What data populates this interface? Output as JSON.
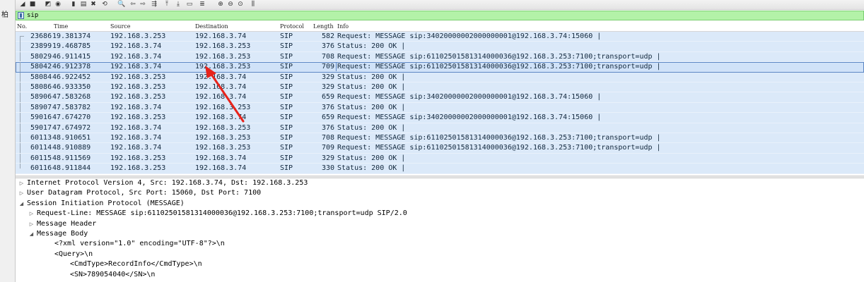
{
  "left_strip": {
    "glyph": "柏"
  },
  "toolbar": {
    "buttons": [
      {
        "name": "open-icon",
        "glyph": "◢"
      },
      {
        "name": "stop-capture-icon",
        "glyph": "■"
      },
      {
        "name": "restart-capture-icon",
        "glyph": "◩"
      },
      {
        "name": "capture-options-icon",
        "glyph": "◉"
      },
      {
        "name": "open-file-icon",
        "glyph": "▮"
      },
      {
        "name": "save-file-icon",
        "glyph": "▤"
      },
      {
        "name": "close-file-icon",
        "glyph": "✖"
      },
      {
        "name": "reload-icon",
        "glyph": "⟲"
      },
      {
        "name": "find-packet-icon",
        "glyph": "🔍"
      },
      {
        "name": "go-back-icon",
        "glyph": "⇦"
      },
      {
        "name": "go-forward-icon",
        "glyph": "⇨"
      },
      {
        "name": "go-to-packet-icon",
        "glyph": "⇶"
      },
      {
        "name": "go-first-icon",
        "glyph": "⤒"
      },
      {
        "name": "go-last-icon",
        "glyph": "⤓"
      },
      {
        "name": "autoscroll-icon",
        "glyph": "▭"
      },
      {
        "name": "colorize-icon",
        "glyph": "≣"
      },
      {
        "name": "zoom-in-icon",
        "glyph": "⊕"
      },
      {
        "name": "zoom-out-icon",
        "glyph": "⊖"
      },
      {
        "name": "zoom-normal-icon",
        "glyph": "⊙"
      },
      {
        "name": "resize-columns-icon",
        "glyph": "⫼"
      }
    ]
  },
  "filter": {
    "value": "sip"
  },
  "packet_list": {
    "columns": [
      "No.",
      "Time",
      "Source",
      "Destination",
      "Protocol",
      "Length",
      "Info"
    ],
    "rows": [
      {
        "no": "23686",
        "time": "19.381374",
        "src": "192.168.3.253",
        "dst": "192.168.3.74",
        "proto": "SIP",
        "len": "582",
        "info": "Request: MESSAGE sip:34020000002000000001@192.168.3.74:15060 |"
      },
      {
        "no": "23899",
        "time": "19.468785",
        "src": "192.168.3.74",
        "dst": "192.168.3.253",
        "proto": "SIP",
        "len": "376",
        "info": "Status: 200 OK |"
      },
      {
        "no": "58029",
        "time": "46.911415",
        "src": "192.168.3.74",
        "dst": "192.168.3.253",
        "proto": "SIP",
        "len": "708",
        "info": "Request: MESSAGE sip:61102501581314000036@192.168.3.253:7100;transport=udp |"
      },
      {
        "no": "58042",
        "time": "46.912378",
        "src": "192.168.3.74",
        "dst": "192.168.3.253",
        "proto": "SIP",
        "len": "709",
        "info": "Request: MESSAGE sip:61102501581314000036@192.168.3.253:7100;transport=udp |",
        "selected": true
      },
      {
        "no": "58084",
        "time": "46.922452",
        "src": "192.168.3.253",
        "dst": "192.168.3.74",
        "proto": "SIP",
        "len": "329",
        "info": "Status: 200 OK |"
      },
      {
        "no": "58086",
        "time": "46.933350",
        "src": "192.168.3.253",
        "dst": "192.168.3.74",
        "proto": "SIP",
        "len": "329",
        "info": "Status: 200 OK |"
      },
      {
        "no": "58906",
        "time": "47.583268",
        "src": "192.168.3.253",
        "dst": "192.168.3.74",
        "proto": "SIP",
        "len": "659",
        "info": "Request: MESSAGE sip:34020000002000000001@192.168.3.74:15060 |"
      },
      {
        "no": "58907",
        "time": "47.583782",
        "src": "192.168.3.74",
        "dst": "192.168.3.253",
        "proto": "SIP",
        "len": "376",
        "info": "Status: 200 OK |"
      },
      {
        "no": "59016",
        "time": "47.674270",
        "src": "192.168.3.253",
        "dst": "192.168.3.74",
        "proto": "SIP",
        "len": "659",
        "info": "Request: MESSAGE sip:34020000002000000001@192.168.3.74:15060 |"
      },
      {
        "no": "59017",
        "time": "47.674972",
        "src": "192.168.3.74",
        "dst": "192.168.3.253",
        "proto": "SIP",
        "len": "376",
        "info": "Status: 200 OK |"
      },
      {
        "no": "60113",
        "time": "48.910651",
        "src": "192.168.3.74",
        "dst": "192.168.3.253",
        "proto": "SIP",
        "len": "708",
        "info": "Request: MESSAGE sip:61102501581314000036@192.168.3.253:7100;transport=udp |"
      },
      {
        "no": "60114",
        "time": "48.910889",
        "src": "192.168.3.74",
        "dst": "192.168.3.253",
        "proto": "SIP",
        "len": "709",
        "info": "Request: MESSAGE sip:61102501581314000036@192.168.3.253:7100;transport=udp |"
      },
      {
        "no": "60115",
        "time": "48.911569",
        "src": "192.168.3.253",
        "dst": "192.168.3.74",
        "proto": "SIP",
        "len": "329",
        "info": "Status: 200 OK |"
      },
      {
        "no": "60116",
        "time": "48.911844",
        "src": "192.168.3.253",
        "dst": "192.168.3.74",
        "proto": "SIP",
        "len": "330",
        "info": "Status: 200 OK |"
      }
    ]
  },
  "details": {
    "lines": [
      {
        "name": "detail-ipv4",
        "twisty": "▷",
        "text": "Internet Protocol Version 4, Src: 192.168.3.74, Dst: 192.168.3.253"
      },
      {
        "name": "detail-udp",
        "twisty": "▷",
        "text": "User Datagram Protocol, Src Port: 15060, Dst Port: 7100"
      },
      {
        "name": "detail-sip",
        "twisty": "◢",
        "text": "Session Initiation Protocol (MESSAGE)"
      },
      {
        "name": "detail-request-line",
        "twisty": "▷",
        "text": "Request-Line: MESSAGE sip:61102501581314000036@192.168.3.253:7100;transport=udp SIP/2.0"
      },
      {
        "name": "detail-message-header",
        "twisty": "▷",
        "text": "Message Header"
      },
      {
        "name": "detail-message-body",
        "twisty": "◢",
        "text": "Message Body"
      },
      {
        "name": "detail-xml-decl",
        "twisty": "",
        "text": "<?xml version=\"1.0\" encoding=\"UTF-8\"?>\\n"
      },
      {
        "name": "detail-query",
        "twisty": "",
        "text": "<Query>\\n"
      },
      {
        "name": "detail-cmdtype",
        "twisty": "",
        "text": "<CmdType>RecordInfo</CmdType>\\n"
      },
      {
        "name": "detail-sn",
        "twisty": "",
        "text": "<SN>789054040</SN>\\n"
      }
    ]
  },
  "colors": {
    "filter_bg": "#b3f2a8",
    "row_bg": "#dbe9f9",
    "annotation_arrow": "#e8241c"
  }
}
